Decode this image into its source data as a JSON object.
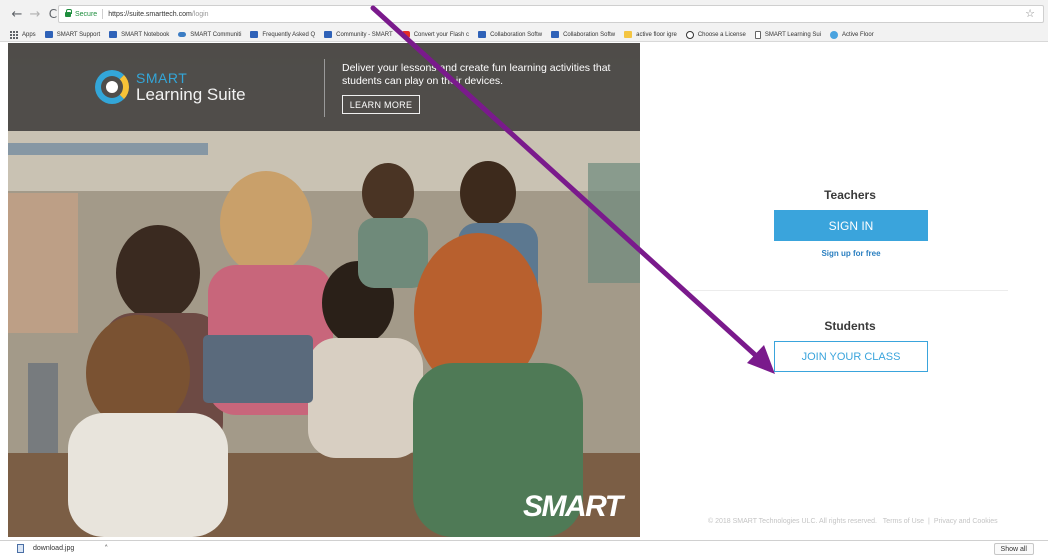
{
  "browser": {
    "nav": {
      "back_icon": "←",
      "forward_icon": "→",
      "reload_icon": "C"
    },
    "address": {
      "secure_label": "Secure",
      "url_host": "https://suite.smarttech.com",
      "url_path": "/login"
    },
    "star_icon": "☆",
    "bookmarks": [
      {
        "label": "Apps",
        "icon": "apps-icon"
      },
      {
        "label": "SMART Support",
        "icon": "smart-icon"
      },
      {
        "label": "SMART Notebook",
        "icon": "smart-icon"
      },
      {
        "label": "SMART Communiti",
        "icon": "cloud-icon"
      },
      {
        "label": "Frequently Asked Q",
        "icon": "smart-icon"
      },
      {
        "label": "Community - SMART",
        "icon": "smart-icon"
      },
      {
        "label": "Convert your Flash c",
        "icon": "youtube-icon"
      },
      {
        "label": "Collaboration Softw",
        "icon": "smart-icon"
      },
      {
        "label": "Collaboration Softw",
        "icon": "smart-icon"
      },
      {
        "label": "active floor igre",
        "icon": "folder-icon"
      },
      {
        "label": "Choose a License",
        "icon": "cc-icon"
      },
      {
        "label": "SMART Learning Sui",
        "icon": "page-icon"
      },
      {
        "label": "Active Floor",
        "icon": "globe-icon"
      }
    ]
  },
  "banner": {
    "brand_small": "SMART",
    "brand_big": "Learning Suite",
    "tagline": "Deliver your lessons and create fun learning activities that students can play on their devices.",
    "learn_more": "LEARN MORE"
  },
  "hero": {
    "wordmark": "SMART"
  },
  "teachers": {
    "heading": "Teachers",
    "sign_in": "SIGN IN",
    "sign_up": "Sign up for free"
  },
  "students": {
    "heading": "Students",
    "join": "JOIN YOUR CLASS"
  },
  "footer": {
    "copyright": "© 2018 SMART Technologies ULC. All rights reserved.",
    "terms": "Terms of Use",
    "sep": "|",
    "privacy": "Privacy and Cookies"
  },
  "downloads": {
    "file": "download.jpg",
    "caret": "˄",
    "show_all": "Show all"
  },
  "colors": {
    "accent": "#3aa4dc",
    "banner": "#4a4846",
    "annotation_arrow": "#7a1a8c",
    "secure": "#1e8e3e"
  }
}
